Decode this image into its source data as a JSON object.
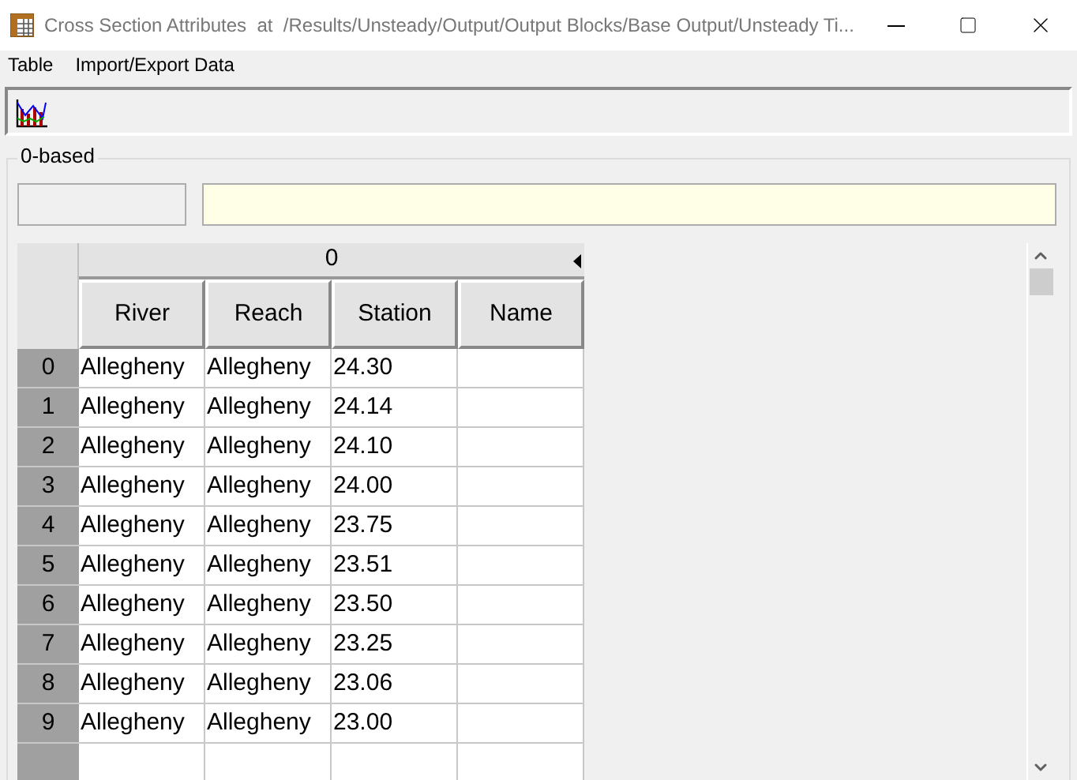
{
  "window": {
    "title": "Cross Section Attributes  at  /Results/Unsteady/Output/Output Blocks/Base Output/Unsteady Ti..."
  },
  "menu": [
    "Table",
    "Import/Export Data"
  ],
  "group": {
    "label": "0-based"
  },
  "table": {
    "group_header": "0",
    "columns": [
      "River",
      "Reach",
      "Station",
      "Name"
    ],
    "rows": [
      {
        "index": "0",
        "cells": [
          "Allegheny",
          "Allegheny",
          "24.30",
          ""
        ]
      },
      {
        "index": "1",
        "cells": [
          "Allegheny",
          "Allegheny",
          "24.14",
          ""
        ]
      },
      {
        "index": "2",
        "cells": [
          "Allegheny",
          "Allegheny",
          "24.10",
          ""
        ]
      },
      {
        "index": "3",
        "cells": [
          "Allegheny",
          "Allegheny",
          "24.00",
          ""
        ]
      },
      {
        "index": "4",
        "cells": [
          "Allegheny",
          "Allegheny",
          "23.75",
          ""
        ]
      },
      {
        "index": "5",
        "cells": [
          "Allegheny",
          "Allegheny",
          "23.51",
          ""
        ]
      },
      {
        "index": "6",
        "cells": [
          "Allegheny",
          "Allegheny",
          "23.50",
          ""
        ]
      },
      {
        "index": "7",
        "cells": [
          "Allegheny",
          "Allegheny",
          "23.25",
          ""
        ]
      },
      {
        "index": "8",
        "cells": [
          "Allegheny",
          "Allegheny",
          "23.06",
          ""
        ]
      },
      {
        "index": "9",
        "cells": [
          "Allegheny",
          "Allegheny",
          "23.00",
          ""
        ]
      }
    ]
  }
}
